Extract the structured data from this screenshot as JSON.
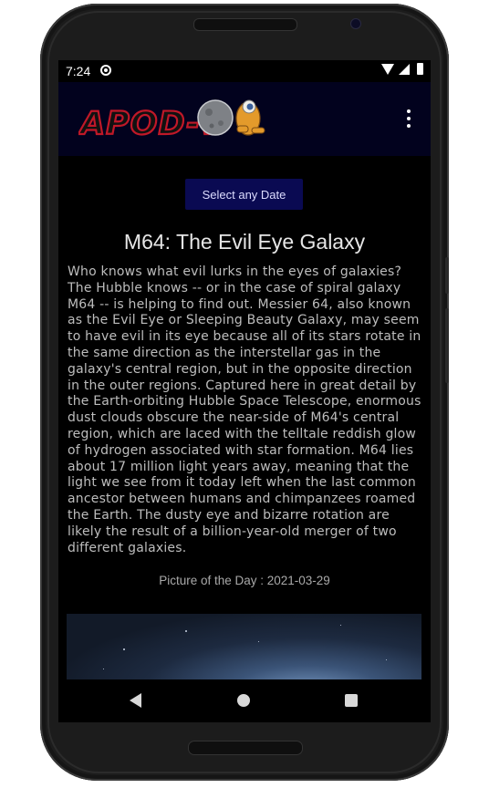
{
  "status_bar": {
    "time": "7:24",
    "icons": [
      "sync-icon",
      "wifi-icon",
      "signal-icon",
      "battery-icon"
    ]
  },
  "app_bar": {
    "logo_text": "APOD-V",
    "menu_icon": "more-vert-icon",
    "background_color": "#02021e"
  },
  "date_button": {
    "label": "Select any Date",
    "color": "#0a0a52"
  },
  "apod": {
    "title": "M64: The Evil Eye Galaxy",
    "explanation": "Who knows what evil lurks in the eyes of galaxies? The Hubble knows -- or in the case of spiral galaxy M64 -- is helping to find out. Messier 64, also known as the Evil Eye or Sleeping Beauty Galaxy, may seem to have evil in its eye because all of its stars rotate in the same direction as the interstellar gas in the galaxy's central region, but in the opposite direction in the outer regions. Captured here in great detail by the Earth-orbiting Hubble Space Telescope, enormous dust clouds obscure the near-side of M64's central region, which are laced with the telltale reddish glow of hydrogen associated with star formation.  M64 lies about 17 million light years away, meaning that the light we see from it today left when the last common ancestor between humans and chimpanzees roamed the Earth.  The dusty eye and bizarre rotation are likely the result of a billion-year-old merger of two different galaxies.",
    "date_label": "Picture of the Day : 2021-03-29"
  },
  "nav_bar": {
    "icons": [
      "back-icon",
      "home-icon",
      "recents-icon"
    ]
  }
}
